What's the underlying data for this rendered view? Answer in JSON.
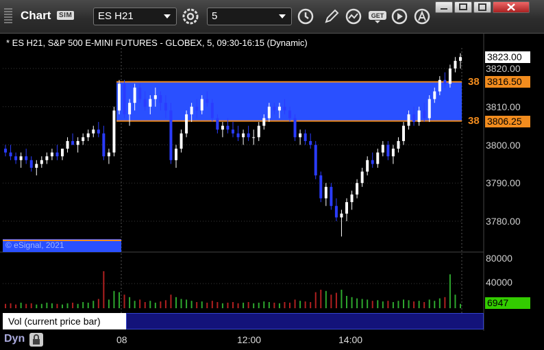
{
  "window": {
    "title": "Chart",
    "badge": "SIM",
    "symbol": "ES H21",
    "interval": "5"
  },
  "chart": {
    "info": "* ES H21, S&P 500 E-MINI FUTURES - GLOBEX, 5, 09:30-16:15 (Dynamic)",
    "copyright": "© eSignal, 2021",
    "price_tags": {
      "last": "3823.00",
      "band_top": "3816.50",
      "band_bottom": "3806.25",
      "band_top_count": "38",
      "band_bottom_count": "38"
    },
    "price_labels": [
      "3820.00",
      "3810.00",
      "3800.00",
      "3790.00",
      "3780.00"
    ],
    "vol_labels": [
      "80000",
      "40000"
    ],
    "vol_tag": "6947",
    "vol_panel_label": "Vol (current price bar)",
    "time_labels": [
      "08",
      "12:00",
      "14:00"
    ],
    "dyn_label": "Dyn",
    "colors": {
      "band": "#2a50ff",
      "band_line": "#f28c1e",
      "up": "#ffffff",
      "down": "#2a3cff",
      "vol_up": "#2ea82e",
      "vol_down": "#b02020"
    }
  },
  "chart_data": {
    "type": "candlestick",
    "ylim": [
      3776,
      3826
    ],
    "bars": [
      [
        3799,
        3800,
        3797,
        3798
      ],
      [
        3798,
        3800,
        3796,
        3797
      ],
      [
        3797,
        3798,
        3795,
        3796
      ],
      [
        3796,
        3798,
        3794,
        3797
      ],
      [
        3797,
        3799,
        3795,
        3796
      ],
      [
        3796,
        3797,
        3793,
        3794
      ],
      [
        3794,
        3796,
        3792,
        3795
      ],
      [
        3795,
        3797,
        3794,
        3796
      ],
      [
        3796,
        3798,
        3795,
        3797
      ],
      [
        3797,
        3799,
        3796,
        3798
      ],
      [
        3798,
        3800,
        3796,
        3797
      ],
      [
        3797,
        3799,
        3796,
        3799
      ],
      [
        3799,
        3802,
        3798,
        3801
      ],
      [
        3801,
        3803,
        3800,
        3800
      ],
      [
        3800,
        3802,
        3798,
        3801
      ],
      [
        3801,
        3803,
        3800,
        3802
      ],
      [
        3802,
        3804,
        3801,
        3803
      ],
      [
        3803,
        3805,
        3802,
        3804
      ],
      [
        3804,
        3806,
        3802,
        3803
      ],
      [
        3803,
        3805,
        3796,
        3797
      ],
      [
        3797,
        3799,
        3795,
        3798
      ],
      [
        3798,
        3810,
        3797,
        3809
      ],
      [
        3809,
        3817,
        3808,
        3816
      ],
      [
        3816,
        3817,
        3807,
        3808
      ],
      [
        3808,
        3812,
        3805,
        3811
      ],
      [
        3811,
        3816,
        3809,
        3815
      ],
      [
        3815,
        3816,
        3811,
        3812
      ],
      [
        3812,
        3814,
        3809,
        3810
      ],
      [
        3810,
        3813,
        3808,
        3812
      ],
      [
        3812,
        3815,
        3810,
        3813
      ],
      [
        3813,
        3814,
        3809,
        3811
      ],
      [
        3811,
        3813,
        3807,
        3809
      ],
      [
        3809,
        3811,
        3795,
        3796
      ],
      [
        3796,
        3800,
        3794,
        3799
      ],
      [
        3799,
        3804,
        3798,
        3803
      ],
      [
        3803,
        3809,
        3802,
        3808
      ],
      [
        3808,
        3811,
        3806,
        3810
      ],
      [
        3810,
        3812,
        3807,
        3809
      ],
      [
        3809,
        3813,
        3808,
        3812
      ],
      [
        3812,
        3814,
        3810,
        3811
      ],
      [
        3811,
        3812,
        3806,
        3807
      ],
      [
        3807,
        3808,
        3803,
        3804
      ],
      [
        3804,
        3806,
        3802,
        3805
      ],
      [
        3805,
        3807,
        3803,
        3804
      ],
      [
        3804,
        3806,
        3802,
        3803
      ],
      [
        3803,
        3805,
        3801,
        3802
      ],
      [
        3802,
        3804,
        3800,
        3803
      ],
      [
        3803,
        3805,
        3801,
        3802
      ],
      [
        3802,
        3804,
        3800,
        3802
      ],
      [
        3802,
        3806,
        3801,
        3805
      ],
      [
        3805,
        3808,
        3804,
        3807
      ],
      [
        3807,
        3811,
        3806,
        3810
      ],
      [
        3810,
        3811,
        3808,
        3809
      ],
      [
        3809,
        3811,
        3807,
        3810
      ],
      [
        3810,
        3812,
        3808,
        3809
      ],
      [
        3809,
        3810,
        3806,
        3807
      ],
      [
        3807,
        3808,
        3801,
        3802
      ],
      [
        3802,
        3804,
        3800,
        3803
      ],
      [
        3803,
        3804,
        3800,
        3801
      ],
      [
        3801,
        3803,
        3799,
        3800
      ],
      [
        3800,
        3801,
        3791,
        3792
      ],
      [
        3792,
        3793,
        3785,
        3786
      ],
      [
        3786,
        3790,
        3784,
        3789
      ],
      [
        3789,
        3790,
        3783,
        3784
      ],
      [
        3784,
        3786,
        3780,
        3781
      ],
      [
        3781,
        3783,
        3776,
        3782
      ],
      [
        3782,
        3786,
        3780,
        3785
      ],
      [
        3785,
        3788,
        3783,
        3787
      ],
      [
        3787,
        3791,
        3786,
        3790
      ],
      [
        3790,
        3794,
        3789,
        3793
      ],
      [
        3793,
        3797,
        3792,
        3796
      ],
      [
        3796,
        3798,
        3794,
        3795
      ],
      [
        3795,
        3799,
        3794,
        3798
      ],
      [
        3798,
        3801,
        3797,
        3800
      ],
      [
        3800,
        3801,
        3796,
        3797
      ],
      [
        3797,
        3800,
        3795,
        3799
      ],
      [
        3799,
        3802,
        3798,
        3801
      ],
      [
        3801,
        3806,
        3800,
        3805
      ],
      [
        3805,
        3809,
        3804,
        3808
      ],
      [
        3808,
        3810,
        3805,
        3806
      ],
      [
        3806,
        3810,
        3805,
        3809
      ],
      [
        3809,
        3811,
        3806,
        3807
      ],
      [
        3807,
        3813,
        3806,
        3812
      ],
      [
        3812,
        3815,
        3811,
        3814
      ],
      [
        3814,
        3818,
        3813,
        3817
      ],
      [
        3817,
        3819,
        3815,
        3816
      ],
      [
        3816,
        3821,
        3815,
        3820
      ],
      [
        3820,
        3823,
        3819,
        3822
      ],
      [
        3822,
        3824,
        3820,
        3823
      ]
    ],
    "volume": [
      7000,
      8000,
      6000,
      9000,
      7000,
      8000,
      6000,
      7000,
      9000,
      8000,
      7000,
      6000,
      8000,
      9000,
      7000,
      10000,
      9000,
      12000,
      15000,
      60000,
      14000,
      28000,
      26000,
      22000,
      18000,
      12000,
      14000,
      10000,
      12000,
      9000,
      11000,
      13000,
      22000,
      18000,
      15000,
      14000,
      12000,
      10000,
      11000,
      9000,
      12000,
      10000,
      8000,
      9000,
      10000,
      8000,
      9000,
      10000,
      8000,
      9000,
      11000,
      10000,
      9000,
      8000,
      10000,
      9000,
      14000,
      12000,
      11000,
      10000,
      26000,
      30000,
      28000,
      22000,
      25000,
      30000,
      20000,
      18000,
      16000,
      15000,
      14000,
      12000,
      13000,
      11000,
      12000,
      10000,
      12000,
      14000,
      13000,
      11000,
      12000,
      10000,
      14000,
      12000,
      16000,
      18000,
      55000,
      22000,
      6947
    ]
  }
}
